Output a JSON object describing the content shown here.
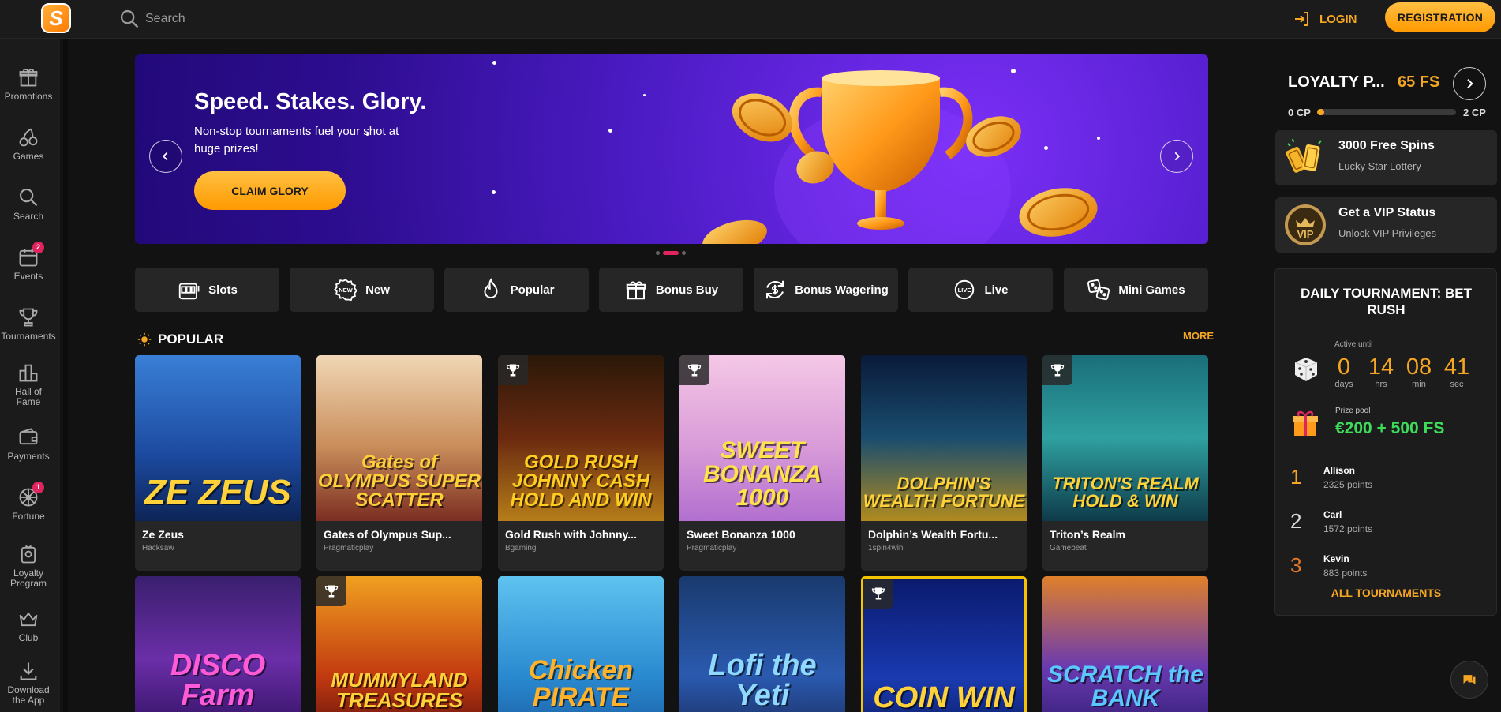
{
  "brand": {
    "logo_letter": "S",
    "accent": "#f5a623",
    "bg": "#121212"
  },
  "header": {
    "search_placeholder": "Search",
    "login_label": "LOGIN",
    "register_label": "REGISTRATION"
  },
  "sidebar": {
    "items": [
      {
        "label": "Promotions",
        "icon": "gift-icon"
      },
      {
        "label": "Games",
        "icon": "cherry-icon"
      },
      {
        "label": "Search",
        "icon": "search-icon"
      },
      {
        "label": "Events",
        "icon": "calendar-icon",
        "badge": "2"
      },
      {
        "label": "Tournaments",
        "icon": "trophy-icon"
      },
      {
        "label": "Hall of Fame",
        "icon": "podium-icon"
      },
      {
        "label": "Payments",
        "icon": "wallet-icon"
      },
      {
        "label": "Fortune",
        "icon": "wheel-icon",
        "badge": "1"
      },
      {
        "label": "Loyalty Program",
        "icon": "loyalty-icon"
      },
      {
        "label": "Club",
        "icon": "crown-icon"
      },
      {
        "label": "Download the App",
        "icon": "download-icon"
      }
    ]
  },
  "hero": {
    "title": "Speed. Stakes. Glory.",
    "subtitle": "Non-stop tournaments fuel your shot at huge prizes!",
    "cta": "CLAIM GLORY",
    "slide_index": 1,
    "slide_count": 3
  },
  "categories": [
    {
      "label": "Slots",
      "icon": "slot-machine-icon"
    },
    {
      "label": "New",
      "icon": "new-badge-icon"
    },
    {
      "label": "Popular",
      "icon": "flame-icon"
    },
    {
      "label": "Bonus Buy",
      "icon": "gift-box-icon"
    },
    {
      "label": "Bonus Wagering",
      "icon": "dollar-cycle-icon"
    },
    {
      "label": "Live",
      "icon": "live-icon"
    },
    {
      "label": "Mini Games",
      "icon": "dice-icon"
    }
  ],
  "popular": {
    "title": "POPULAR",
    "more": "MORE",
    "games": [
      {
        "name": "Ze Zeus",
        "provider": "Hacksaw",
        "art": "ZE ZEUS",
        "trophy": false
      },
      {
        "name": "Gates of Olympus Sup...",
        "provider": "Pragmaticplay",
        "art": "Gates of OLYMPUS SUPER SCATTER",
        "trophy": false
      },
      {
        "name": "Gold Rush with Johnny...",
        "provider": "Bgaming",
        "art": "GOLD RUSH JOHNNY CASH HOLD AND WIN",
        "trophy": true
      },
      {
        "name": "Sweet Bonanza 1000",
        "provider": "Pragmaticplay",
        "art": "SWEET BONANZA 1000",
        "trophy": true
      },
      {
        "name": "Dolphin’s Wealth Fortu...",
        "provider": "1spin4win",
        "art": "DOLPHIN'S WEALTH FORTUNE",
        "trophy": false
      },
      {
        "name": "Triton’s Realm",
        "provider": "Gamebeat",
        "art": "TRITON'S REALM HOLD & WIN",
        "trophy": true
      },
      {
        "art": "DISCO Farm",
        "trophy": false
      },
      {
        "art": "MUMMYLAND TREASURES",
        "trophy": true
      },
      {
        "art": "Chicken PIRATE",
        "trophy": false
      },
      {
        "art": "Lofi the Yeti",
        "trophy": false
      },
      {
        "art": "COIN WIN",
        "trophy": true
      },
      {
        "art": "SCRATCH the BANK",
        "trophy": false
      }
    ]
  },
  "loyalty": {
    "title": "LOYALTY P...",
    "fs": "65 FS",
    "cp_min": "0 CP",
    "cp_max": "2 CP",
    "progress_fraction": 0.05
  },
  "promos": [
    {
      "title": "3000 Free Spins",
      "subtitle": "Lucky Star Lottery",
      "icon": "tickets-icon"
    },
    {
      "title": "Get a VIP Status",
      "subtitle": "Unlock VIP Privileges",
      "icon": "vip-icon",
      "badge_text": "VIP"
    }
  ],
  "tournament": {
    "title": "DAILY TOURNAMENT: BET RUSH",
    "active_until": "Active until",
    "countdown": [
      {
        "value": "0",
        "unit": "days"
      },
      {
        "value": "14",
        "unit": "hrs"
      },
      {
        "value": "08",
        "unit": "min"
      },
      {
        "value": "41",
        "unit": "sec"
      }
    ],
    "prize_label": "Prize pool",
    "prize_value": "€200 + 500 FS",
    "leaders": [
      {
        "rank": "1",
        "name": "Allison",
        "points": "2325 points"
      },
      {
        "rank": "2",
        "name": "Carl",
        "points": "1572 points"
      },
      {
        "rank": "3",
        "name": "Kevin",
        "points": "883 points"
      }
    ],
    "all_link": "ALL TOURNAMENTS"
  }
}
